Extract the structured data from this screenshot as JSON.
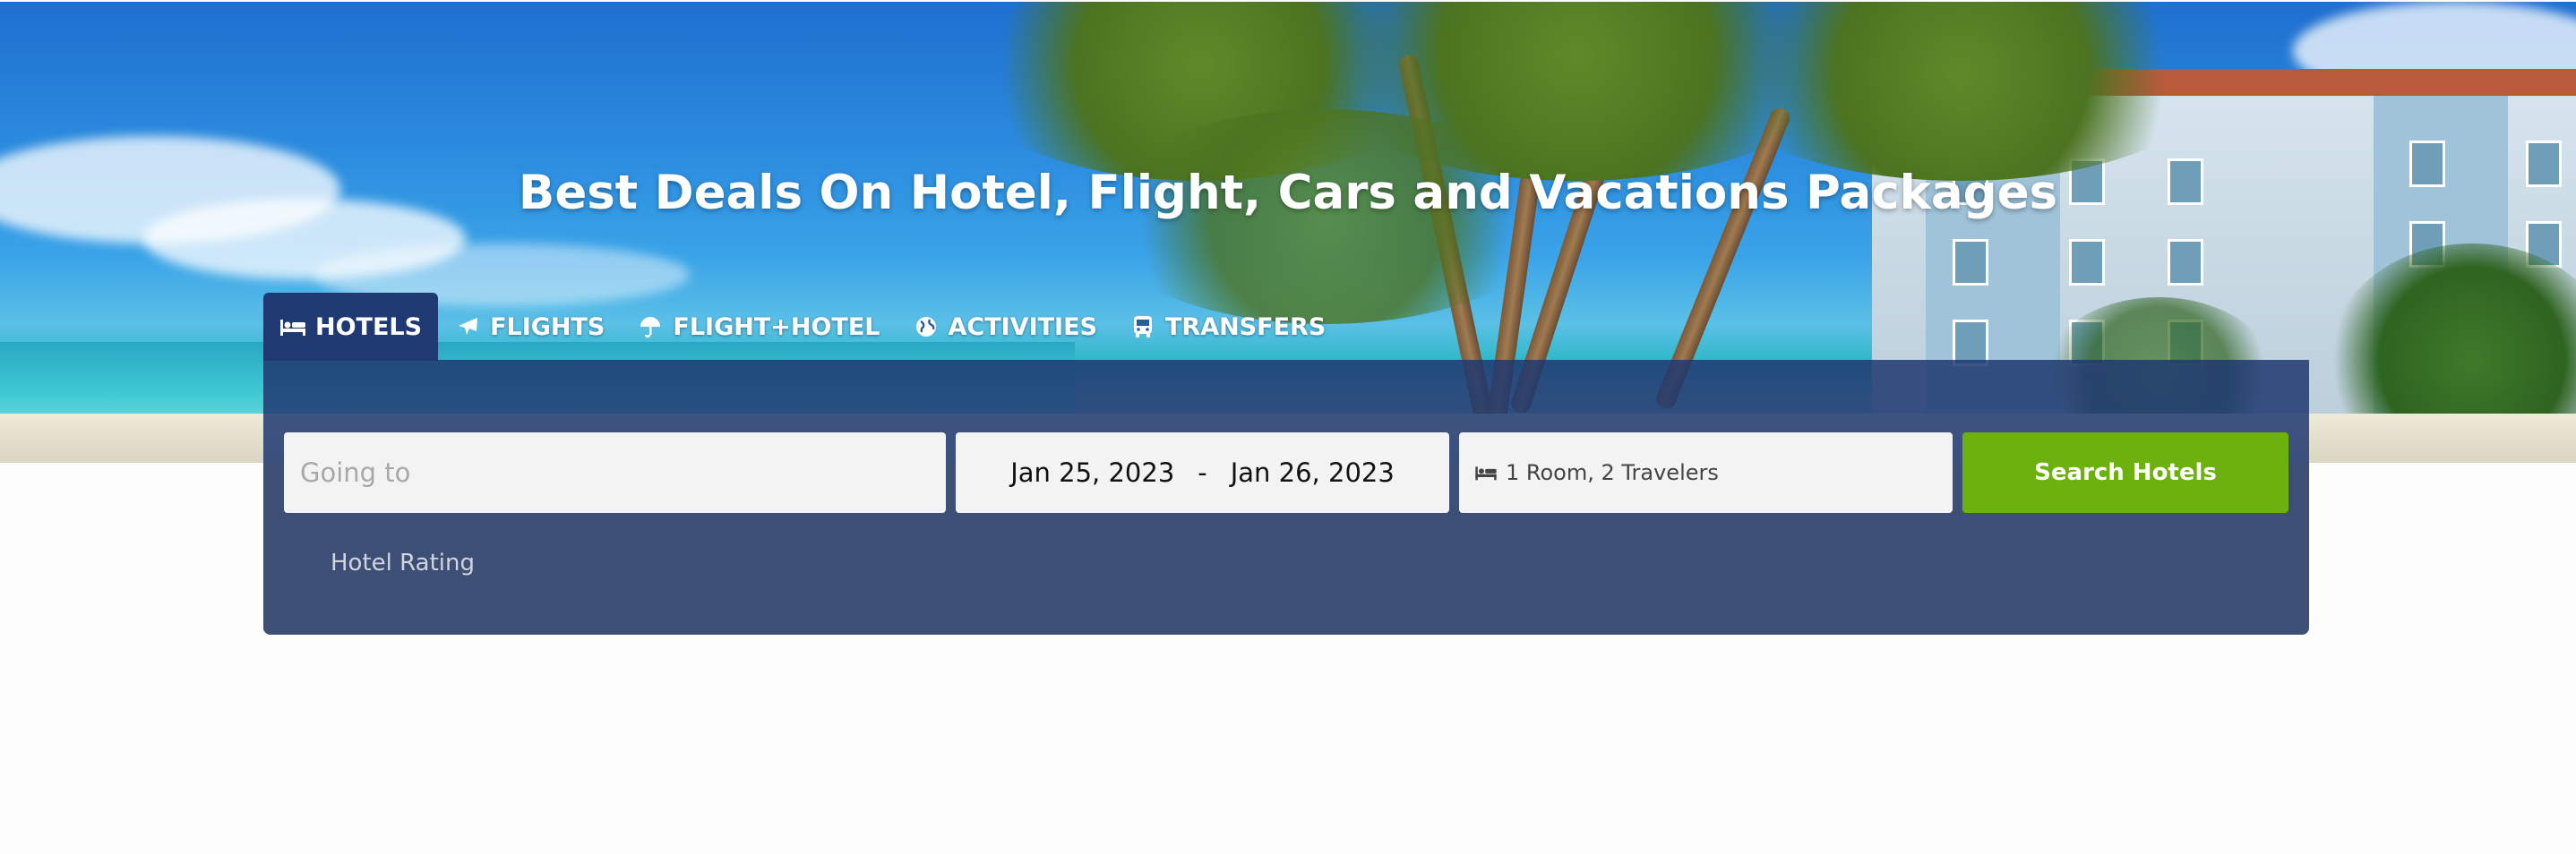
{
  "hero": {
    "title": "Best Deals On Hotel, Flight, Cars and Vacations Packages"
  },
  "tabs": [
    {
      "label": "HOTELS",
      "icon": "bed-icon",
      "active": true
    },
    {
      "label": "FLIGHTS",
      "icon": "plane-icon",
      "active": false
    },
    {
      "label": "FLIGHT+HOTEL",
      "icon": "umbrella-icon",
      "active": false
    },
    {
      "label": "ACTIVITIES",
      "icon": "globe-icon",
      "active": false
    },
    {
      "label": "TRANSFERS",
      "icon": "bus-icon",
      "active": false
    }
  ],
  "search": {
    "destination_placeholder": "Going to",
    "checkin": "Jan 25, 2023",
    "date_separator": "-",
    "checkout": "Jan 26, 2023",
    "guests": "1 Room, 2 Travelers",
    "guests_icon": "bed-icon",
    "button_label": "Search Hotels",
    "rating_label": "Hotel Rating"
  },
  "colors": {
    "active_tab": "#1f3a72",
    "panel": "#3e4f75",
    "button": "#6cb10d",
    "field": "#f3f3f3"
  }
}
